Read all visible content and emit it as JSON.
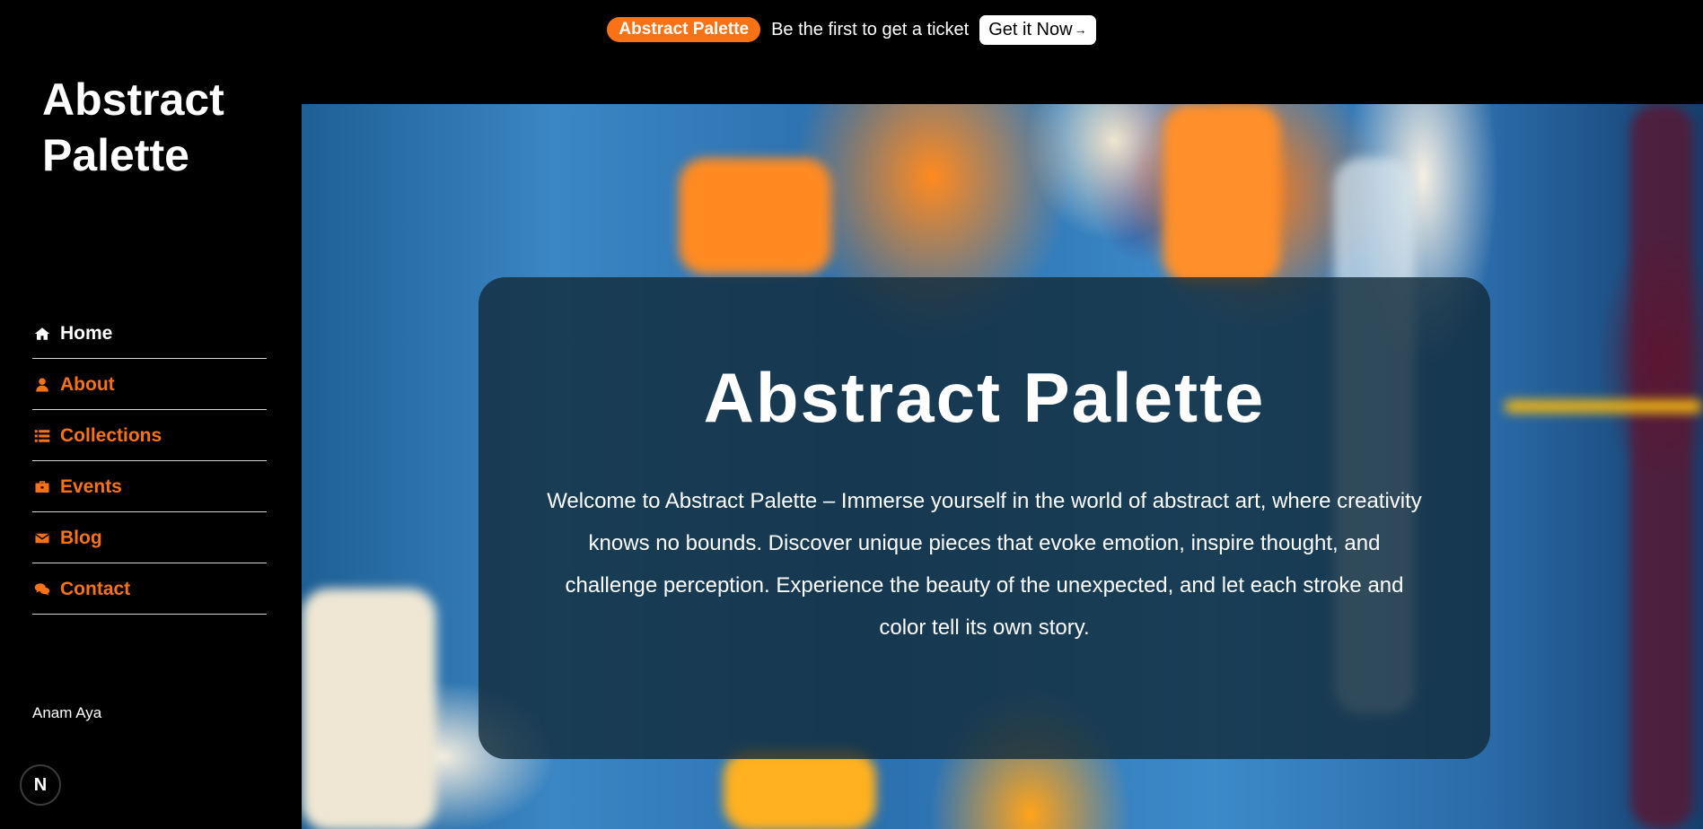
{
  "announcement": {
    "badge": "Abstract Palette",
    "message": "Be the first to get a ticket",
    "cta_label": "Get it Now",
    "cta_arrow": "→"
  },
  "sidebar": {
    "brand": "Abstract Palette",
    "nav": [
      {
        "label": "Home",
        "icon": "home-icon",
        "active": true
      },
      {
        "label": "About",
        "icon": "user-icon",
        "active": false
      },
      {
        "label": "Collections",
        "icon": "list-icon",
        "active": false
      },
      {
        "label": "Events",
        "icon": "briefcase-icon",
        "active": false
      },
      {
        "label": "Blog",
        "icon": "envelope-icon",
        "active": false
      },
      {
        "label": "Contact",
        "icon": "comments-icon",
        "active": false
      }
    ],
    "author": "Anam Aya",
    "dev_badge": "N"
  },
  "hero": {
    "title": "Abstract Palette",
    "description": "Welcome to Abstract Palette – Immerse yourself in the world of abstract art, where creativity knows no bounds. Discover unique pieces that evoke emotion, inspire thought, and challenge perception. Experience the beauty of the unexpected, and let each stroke and color tell its own story."
  },
  "colors": {
    "accent": "#f97316",
    "background": "#000000",
    "nav_divider": "#d4d4d4",
    "panel": "rgba(18,42,58,0.80)"
  }
}
